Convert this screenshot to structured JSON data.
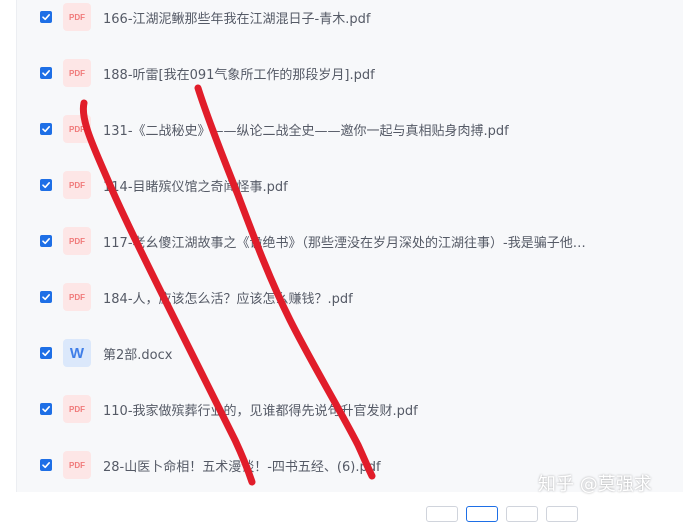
{
  "files": [
    {
      "type": "pdf",
      "icon_label": "PDF",
      "name": "166-江湖泥鳅那些年我在江湖混日子-青木.pdf",
      "checked": true
    },
    {
      "type": "pdf",
      "icon_label": "PDF",
      "name": "188-听雷[我在091气象所工作的那段岁月].pdf",
      "checked": true
    },
    {
      "type": "pdf",
      "icon_label": "PDF",
      "name": "131-《二战秘史》——纵论二战全史——邀你一起与真相贴身肉搏.pdf",
      "checked": true
    },
    {
      "type": "pdf",
      "icon_label": "PDF",
      "name": "114-目睹殡仪馆之奇闻怪事.pdf",
      "checked": true
    },
    {
      "type": "pdf",
      "icon_label": "PDF",
      "name": "117-老幺傻江湖故事之《诡绝书》（那些湮没在岁月深处的江湖往事）-我是骗子他…",
      "checked": true
    },
    {
      "type": "pdf",
      "icon_label": "PDF",
      "name": "184-人，应该怎么活？应该怎么赚钱？.pdf",
      "checked": true
    },
    {
      "type": "doc",
      "icon_label": "W",
      "name": "第2部.docx",
      "checked": true
    },
    {
      "type": "pdf",
      "icon_label": "PDF",
      "name": "110-我家做殡葬行业的，见谁都得先说句升官发财.pdf",
      "checked": true
    },
    {
      "type": "pdf",
      "icon_label": "PDF",
      "name": "28-山医卜命相！五术漫谈！-四书五经、(6).pdf",
      "checked": true
    }
  ],
  "watermark": "知乎 @莫强求",
  "colors": {
    "checkbox": "#1e6fe6",
    "annotation_stroke": "#e11d2a",
    "panel_bg": "#f7f8fa"
  }
}
